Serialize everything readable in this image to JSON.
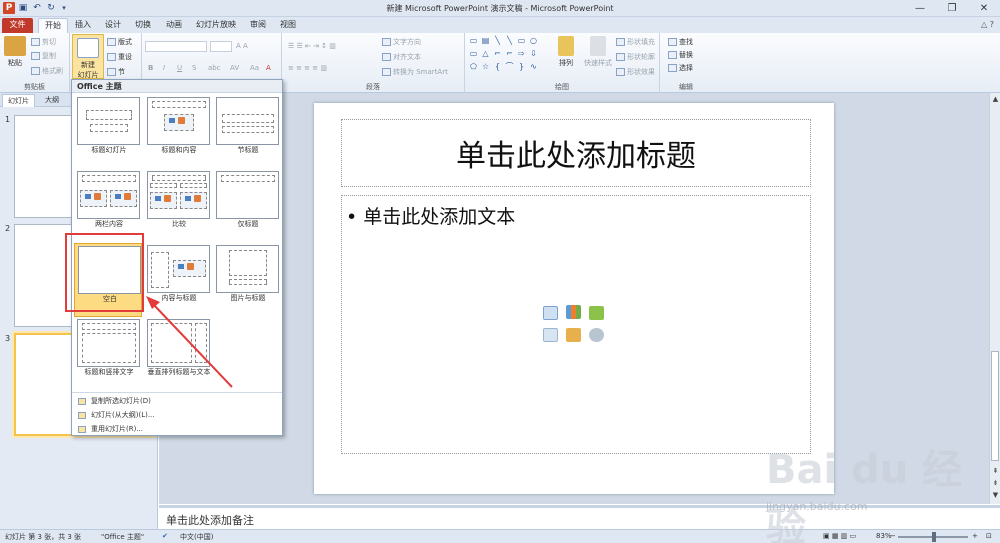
{
  "window": {
    "title": "新建 Microsoft PowerPoint 演示文稿 - Microsoft PowerPoint"
  },
  "tabs": [
    "文件",
    "开始",
    "插入",
    "设计",
    "切换",
    "动画",
    "幻灯片放映",
    "审阅",
    "视图"
  ],
  "ribbon": {
    "clipboard": {
      "paste": "粘贴",
      "cut": "剪切",
      "copy": "复制",
      "format_painter": "格式刷",
      "label": "剪贴板"
    },
    "slides": {
      "new_slide": "新建",
      "new_slide_line2": "幻灯片",
      "layout": "版式",
      "reset": "重设",
      "section": "节"
    },
    "paragraph": {
      "text_direction": "文字方向",
      "align_text": "对齐文本",
      "smartart": "转换为 SmartArt",
      "label": "段落"
    },
    "drawing": {
      "arrange": "排列",
      "quick_styles": "快速样式",
      "shape_fill": "形状填充",
      "shape_outline": "形状轮廓",
      "shape_effects": "形状效果",
      "label": "绘图"
    },
    "editing": {
      "find": "查找",
      "replace": "替换",
      "select": "选择",
      "label": "编辑"
    }
  },
  "left_panel": {
    "tab_slides": "幻灯片",
    "tab_outline": "大纲",
    "slide_numbers": [
      "1",
      "2",
      "3"
    ]
  },
  "gallery": {
    "header": "Office 主题",
    "layouts": [
      "标题幻灯片",
      "标题和内容",
      "节标题",
      "两栏内容",
      "比较",
      "仅标题",
      "空白",
      "内容与标题",
      "图片与标题",
      "标题和竖排文字",
      "垂直排列标题与文本"
    ],
    "menu": [
      "复制所选幻灯片(D)",
      "幻灯片(从大纲)(L)...",
      "重用幻灯片(R)..."
    ]
  },
  "slide": {
    "title_placeholder": "单击此处添加标题",
    "content_placeholder": "单击此处添加文本"
  },
  "notes": {
    "placeholder": "单击此处添加备注"
  },
  "status": {
    "slide_info": "幻灯片 第 3 张，共 3 张",
    "theme": "\"Office 主题\"",
    "language": "中文(中国)",
    "zoom": "83%"
  },
  "watermark": {
    "brand": "Bai du 经验",
    "url": "jingyan.baidu.com"
  }
}
